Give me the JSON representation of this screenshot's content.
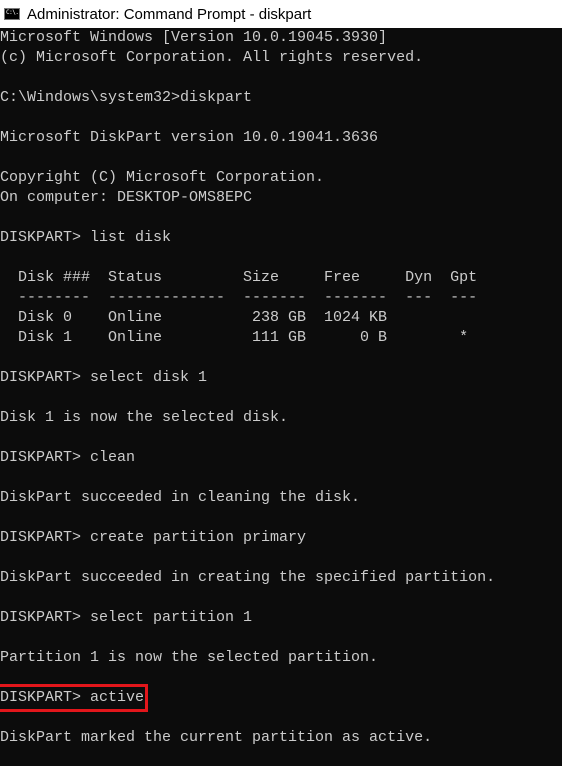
{
  "window": {
    "title": "Administrator: Command Prompt - diskpart",
    "icon_text": "C:\\."
  },
  "console": {
    "lines": [
      "Microsoft Windows [Version 10.0.19045.3930]",
      "(c) Microsoft Corporation. All rights reserved.",
      "",
      "C:\\Windows\\system32>diskpart",
      "",
      "Microsoft DiskPart version 10.0.19041.3636",
      "",
      "Copyright (C) Microsoft Corporation.",
      "On computer: DESKTOP-OMS8EPC",
      "",
      "DISKPART> list disk",
      "",
      "  Disk ###  Status         Size     Free     Dyn  Gpt",
      "  --------  -------------  -------  -------  ---  ---",
      "  Disk 0    Online          238 GB  1024 KB",
      "  Disk 1    Online          111 GB      0 B        *",
      "",
      "DISKPART> select disk 1",
      "",
      "Disk 1 is now the selected disk.",
      "",
      "DISKPART> clean",
      "",
      "DiskPart succeeded in cleaning the disk.",
      "",
      "DISKPART> create partition primary",
      "",
      "DiskPart succeeded in creating the specified partition.",
      "",
      "DISKPART> select partition 1",
      "",
      "Partition 1 is now the selected partition.",
      "",
      "DISKPART> active",
      "",
      "DiskPart marked the current partition as active."
    ]
  }
}
